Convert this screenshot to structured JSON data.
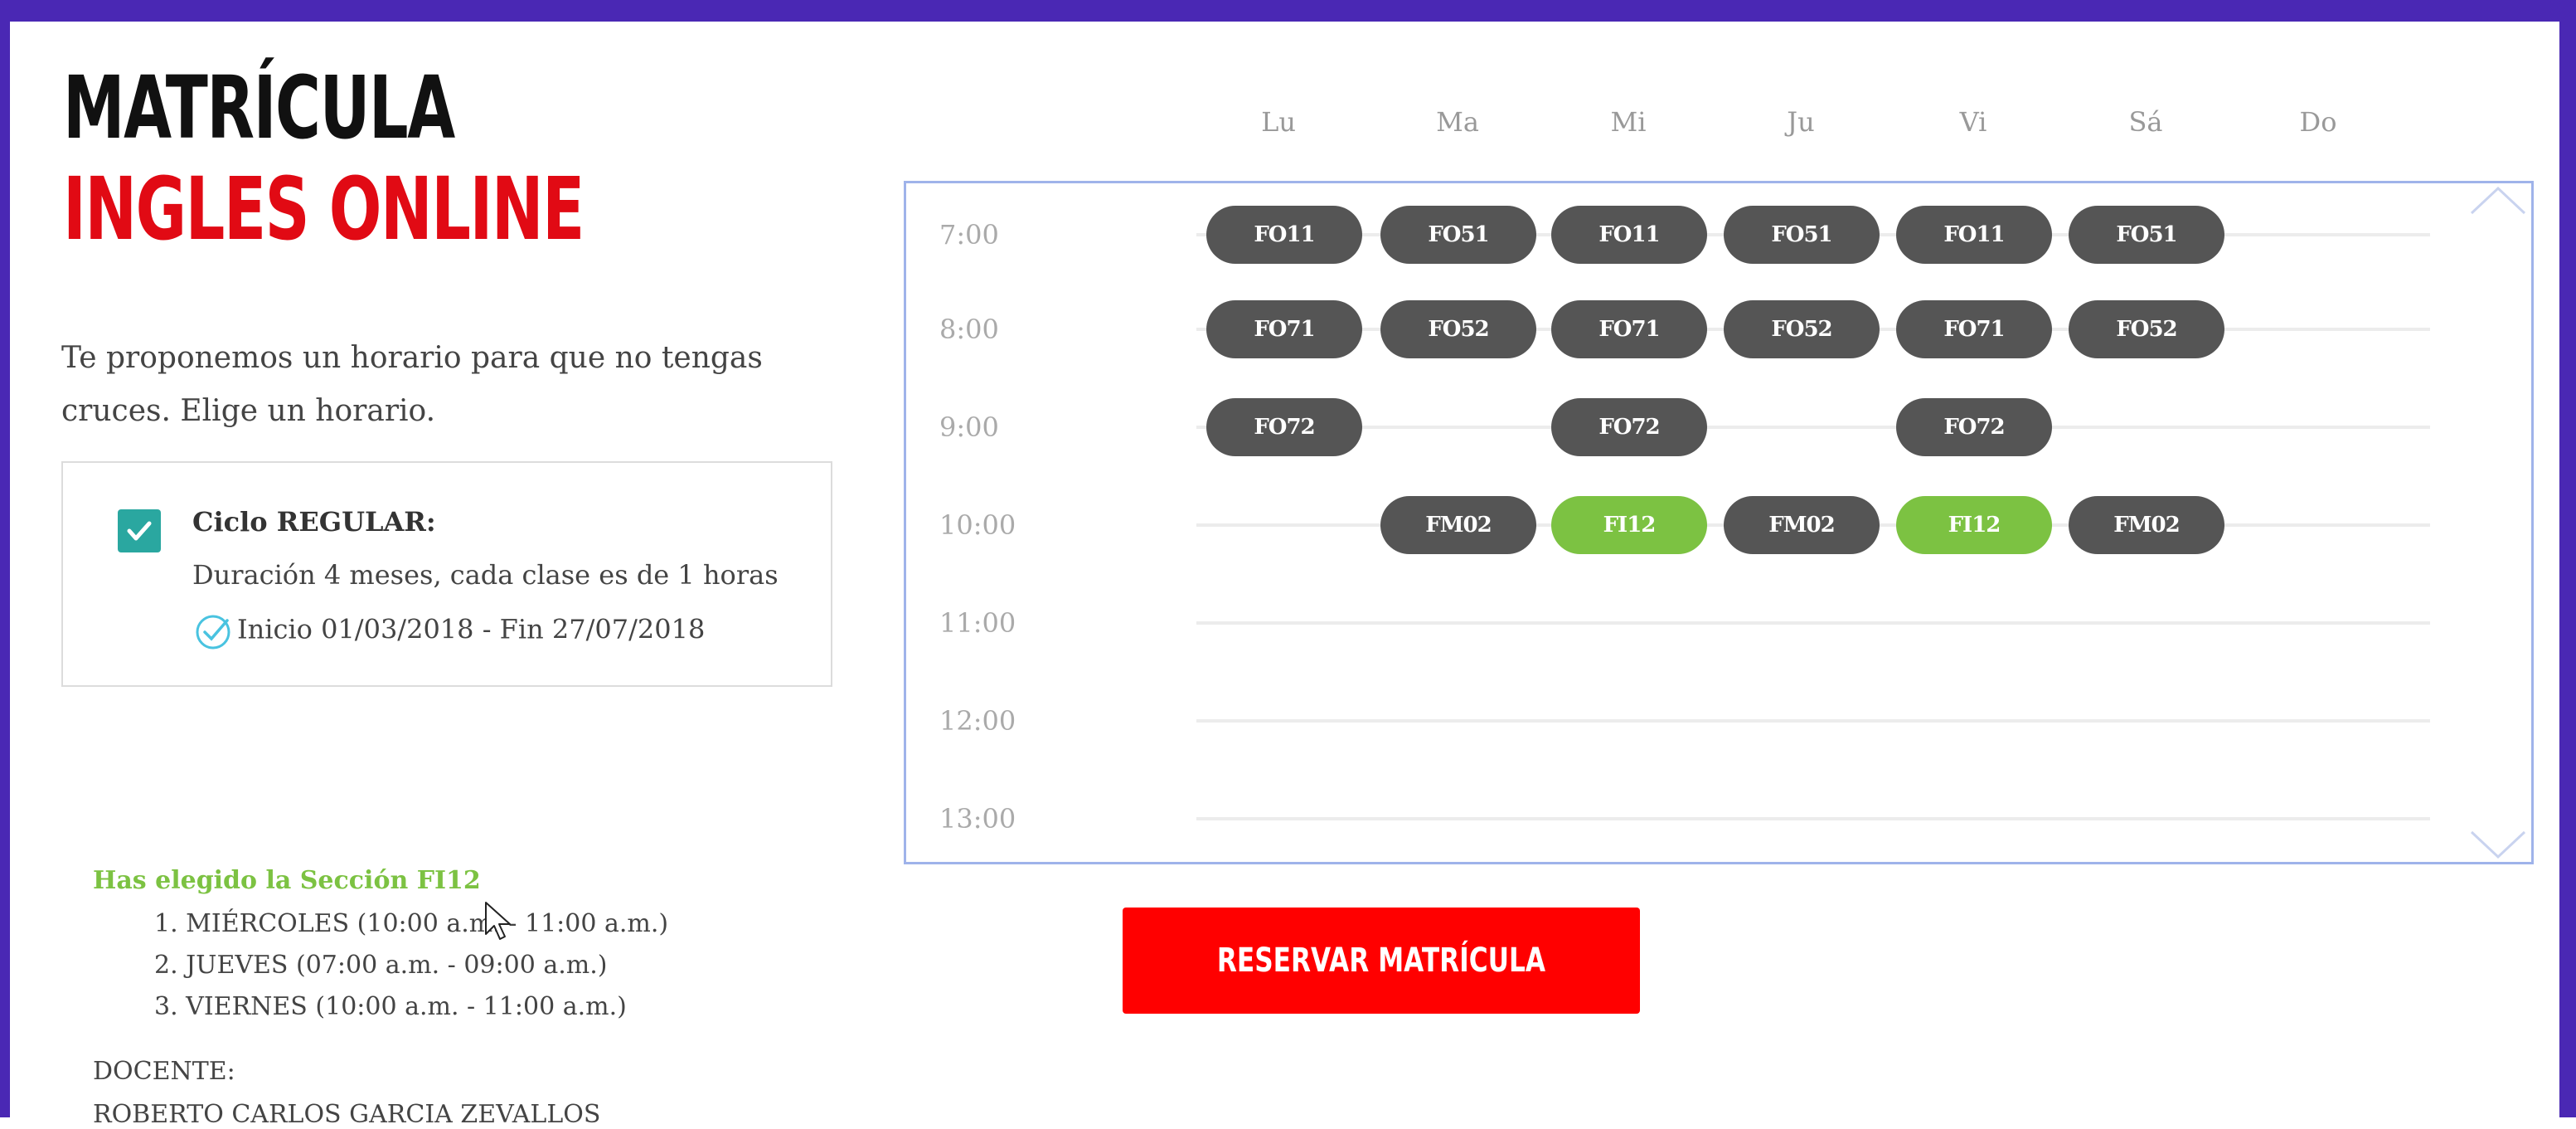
{
  "header": {
    "title_line1": "MATRÍCULA",
    "title_line2": "INGLES ONLINE"
  },
  "intro_text": "Te proponemos un horario para que no tengas cruces. Elige un horario.",
  "cycle": {
    "checked": true,
    "title": "Ciclo REGULAR:",
    "description": "Duración 4 meses, cada clase es de 1 horas",
    "dates": "Inicio 01/03/2018 - Fin 27/07/2018",
    "icon": "check-circle-icon"
  },
  "schedule": {
    "days": [
      "Lu",
      "Ma",
      "Mi",
      "Ju",
      "Vi",
      "Sá",
      "Do"
    ],
    "hours": [
      "7:00",
      "8:00",
      "9:00",
      "10:00",
      "11:00",
      "12:00",
      "13:00"
    ],
    "rows": [
      {
        "hour": "7:00",
        "slots": [
          "FO11",
          "FO51",
          "FO11",
          "FO51",
          "FO11",
          "FO51",
          ""
        ]
      },
      {
        "hour": "8:00",
        "slots": [
          "FO71",
          "FO52",
          "FO71",
          "FO52",
          "FO71",
          "FO52",
          ""
        ]
      },
      {
        "hour": "9:00",
        "slots": [
          "FO72",
          "",
          "FO72",
          "",
          "FO72",
          "",
          ""
        ]
      },
      {
        "hour": "10:00",
        "slots": [
          "",
          "FM02",
          "FI12",
          "FM02",
          "FI12",
          "FM02",
          ""
        ]
      },
      {
        "hour": "11:00",
        "slots": [
          "",
          "",
          "",
          "",
          "",
          "",
          ""
        ]
      },
      {
        "hour": "12:00",
        "slots": [
          "",
          "",
          "",
          "",
          "",
          "",
          ""
        ]
      },
      {
        "hour": "13:00",
        "slots": [
          "",
          "",
          "",
          "",
          "",
          "",
          ""
        ]
      }
    ],
    "selected_code": "FI12",
    "chip_color": "#555555",
    "selected_color": "#7cc242"
  },
  "selection": {
    "heading": "Has elegido la Sección FI12",
    "sessions": [
      "1. MIÉRCOLES (10:00 a.m. - 11:00 a.m.)",
      "2. JUEVES (07:00 a.m. - 09:00 a.m.)",
      "3. VIERNES (10:00 a.m. - 11:00 a.m.)"
    ]
  },
  "teacher": {
    "label": "DOCENTE:",
    "name": "ROBERTO CARLOS GARCIA ZEVALLOS"
  },
  "reserve_button": {
    "label": "RESERVAR MATRÍCULA",
    "color": "#ff0000"
  },
  "colors": {
    "frame": "#4a28b4",
    "brand_red": "#e10a14",
    "check_teal": "#2aa7a0"
  }
}
